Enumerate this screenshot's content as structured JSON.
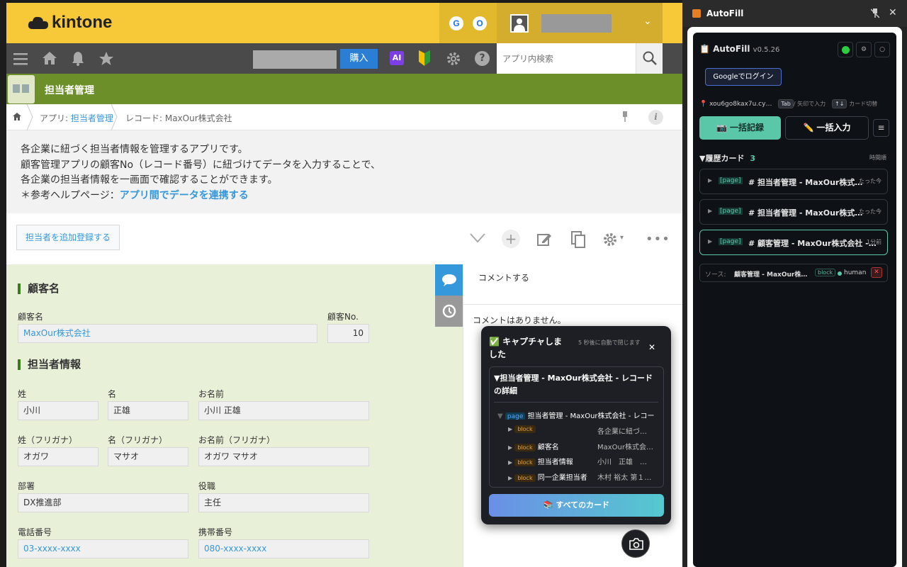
{
  "kintone": {
    "logo": "kintone",
    "header": {
      "circle_g": "G",
      "circle_o": "O",
      "search_placeholder": "アプリ内検索",
      "buy_label": "購入",
      "ai_label": "AI"
    },
    "app_title": "担当者管理",
    "breadcrumb": {
      "app_prefix": "アプリ: ",
      "app_link": "担当者管理",
      "record": "レコード: MaxOur株式会社"
    },
    "description": {
      "line1": "各企業に紐づく担当者情報を管理するアプリです。",
      "line2": "顧客管理アプリの顧客No（レコード番号）に紐づけてデータを入力することで、",
      "line3": "各企業の担当者情報を一画面で確認することができます。",
      "line4_prefix": "＊参考ヘルプページ：",
      "line4_link": "アプリ間でデータを連携する"
    },
    "add_button": "担当者を追加登録する",
    "form": {
      "section1": "顧客名",
      "customer_label": "顧客名",
      "customer_value": "MaxOur株式会社",
      "customer_no_label": "顧客No.",
      "customer_no_value": "10",
      "section2": "担当者情報",
      "last_label": "姓",
      "last_value": "小川",
      "first_label": "名",
      "first_value": "正雄",
      "full_label": "お名前",
      "full_value": "小川 正雄",
      "last_kana_label": "姓（フリガナ）",
      "last_kana_value": "オガワ",
      "first_kana_label": "名（フリガナ）",
      "first_kana_value": "マサオ",
      "full_kana_label": "お名前（フリガナ）",
      "full_kana_value": "オガワ マサオ",
      "dept_label": "部署",
      "dept_value": "DX推進部",
      "role_label": "役職",
      "role_value": "主任",
      "phone_label": "電話番号",
      "phone_value": "03-xxxx-xxxx",
      "mobile_label": "携帯番号",
      "mobile_value": "080-xxxx-xxxx"
    },
    "comment": {
      "placeholder": "コメントする",
      "empty": "コメントはありません。"
    }
  },
  "popup": {
    "title": "✅ キャプチャしました",
    "auto_close": "5 秒後に自動で閉じます",
    "close": "✕",
    "tree_root": "▼担当者管理 - MaxOur株式会社 - レコードの詳細",
    "rows": [
      {
        "tag": "page",
        "title": "担当者管理 - MaxOur株式会社 - レコー",
        "preview": ""
      },
      {
        "tag": "block",
        "title": "",
        "preview": "各企業に紐づ…"
      },
      {
        "tag": "block",
        "title": "顧客名",
        "preview": "MaxOur株式会…"
      },
      {
        "tag": "block",
        "title": "担当者情報",
        "preview": "小川　正雄　…"
      },
      {
        "tag": "block",
        "title": "同一企業担当者",
        "preview": "木村 裕太 第１…"
      }
    ],
    "all_cards": "📚 すべてのカード"
  },
  "autofill": {
    "window_title": "AutoFill",
    "app_name": "📋 AutoFill",
    "version": "v0.5.26",
    "google_login": "Googleでログイン",
    "device_id": "📍 xou6go8kax7u.cy…",
    "tab_key": "Tab",
    "tab_hint": "/ 矢印で入力",
    "arrow_key": "↑↓",
    "arrow_hint": "カード切替",
    "bulk_record": "📷 一括記録",
    "bulk_input": "✏️ 一括入力",
    "menu": "≡",
    "history_title": "▼履歴カード",
    "history_count": "3",
    "sort": "時間順",
    "cards": [
      {
        "tag": "[page]",
        "title": "# 担当者管理 - MaxOur株式…",
        "time": "たった今"
      },
      {
        "tag": "[page]",
        "title": "# 担当者管理 - MaxOur株式…",
        "time": "たった今"
      },
      {
        "tag": "[page]",
        "title": "# 顧客管理 - MaxOur株式会社 -…",
        "time": "1分前"
      }
    ],
    "source": {
      "label": "ソース:",
      "title": "顧客管理 - MaxOur株…",
      "tag": "block",
      "human": "human",
      "remove": "✕"
    }
  }
}
